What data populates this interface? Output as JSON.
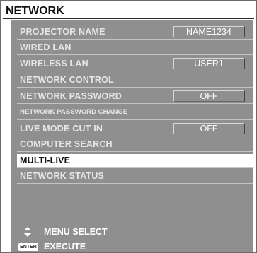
{
  "title": "NETWORK",
  "menu": {
    "items": [
      {
        "label": "PROJECTOR NAME",
        "value": "NAME1234"
      },
      {
        "label": "WIRED LAN"
      },
      {
        "label": "WIRELESS LAN",
        "value": "USER1"
      },
      {
        "label": "NETWORK CONTROL"
      },
      {
        "label": "NETWORK PASSWORD",
        "value": "OFF"
      },
      {
        "label": "NETWORK PASSWORD CHANGE"
      },
      {
        "label": "LIVE MODE CUT IN",
        "value": "OFF"
      },
      {
        "label": "COMPUTER SEARCH"
      },
      {
        "label": "MULTI-LIVE",
        "selected": true
      },
      {
        "label": "NETWORK STATUS"
      }
    ]
  },
  "footer": {
    "menu_select_label": "MENU SELECT",
    "enter_badge": "ENTER",
    "execute_label": "EXECUTE"
  },
  "colors": {
    "panel": "#8f8f8f",
    "selected_row": "#ffffff",
    "text_light": "#e6e6e6"
  }
}
